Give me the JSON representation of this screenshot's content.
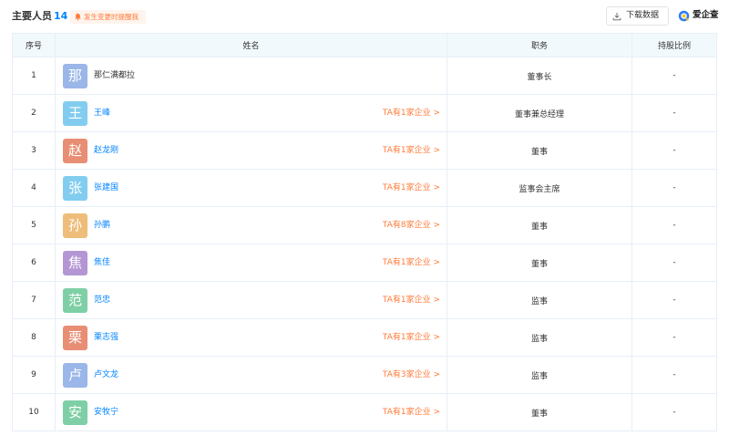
{
  "header": {
    "title": "主要人员",
    "count": "14",
    "remind_label": "发生变更时提醒我",
    "download_label": "下载数据",
    "brand": "爱企查"
  },
  "table": {
    "columns": [
      "序号",
      "姓名",
      "职务",
      "持股比例"
    ],
    "rows": [
      {
        "index": "1",
        "avatar_char": "那",
        "avatar_color": "#9bb6e8",
        "name": "那仁满都拉",
        "is_link": false,
        "enterprises": "",
        "position": "董事长",
        "share": "-"
      },
      {
        "index": "2",
        "avatar_char": "王",
        "avatar_color": "#82cdef",
        "name": "王峰",
        "is_link": true,
        "enterprises": "TA有1家企业 >",
        "position": "董事兼总经理",
        "share": "-"
      },
      {
        "index": "3",
        "avatar_char": "赵",
        "avatar_color": "#e88e74",
        "name": "赵龙刚",
        "is_link": true,
        "enterprises": "TA有1家企业 >",
        "position": "董事",
        "share": "-"
      },
      {
        "index": "4",
        "avatar_char": "张",
        "avatar_color": "#82cdef",
        "name": "张建国",
        "is_link": true,
        "enterprises": "TA有1家企业 >",
        "position": "监事会主席",
        "share": "-"
      },
      {
        "index": "5",
        "avatar_char": "孙",
        "avatar_color": "#eebd7a",
        "name": "孙鹏",
        "is_link": true,
        "enterprises": "TA有8家企业 >",
        "position": "董事",
        "share": "-"
      },
      {
        "index": "6",
        "avatar_char": "焦",
        "avatar_color": "#b596d4",
        "name": "焦佳",
        "is_link": true,
        "enterprises": "TA有1家企业 >",
        "position": "董事",
        "share": "-"
      },
      {
        "index": "7",
        "avatar_char": "范",
        "avatar_color": "#7fcfa6",
        "name": "范忠",
        "is_link": true,
        "enterprises": "TA有1家企业 >",
        "position": "监事",
        "share": "-"
      },
      {
        "index": "8",
        "avatar_char": "栗",
        "avatar_color": "#e88e74",
        "name": "栗志强",
        "is_link": true,
        "enterprises": "TA有1家企业 >",
        "position": "监事",
        "share": "-"
      },
      {
        "index": "9",
        "avatar_char": "卢",
        "avatar_color": "#9bb6e8",
        "name": "卢文龙",
        "is_link": true,
        "enterprises": "TA有3家企业 >",
        "position": "监事",
        "share": "-"
      },
      {
        "index": "10",
        "avatar_char": "安",
        "avatar_color": "#7fcfa6",
        "name": "安牧宁",
        "is_link": true,
        "enterprises": "TA有1家企业 >",
        "position": "董事",
        "share": "-"
      }
    ]
  }
}
